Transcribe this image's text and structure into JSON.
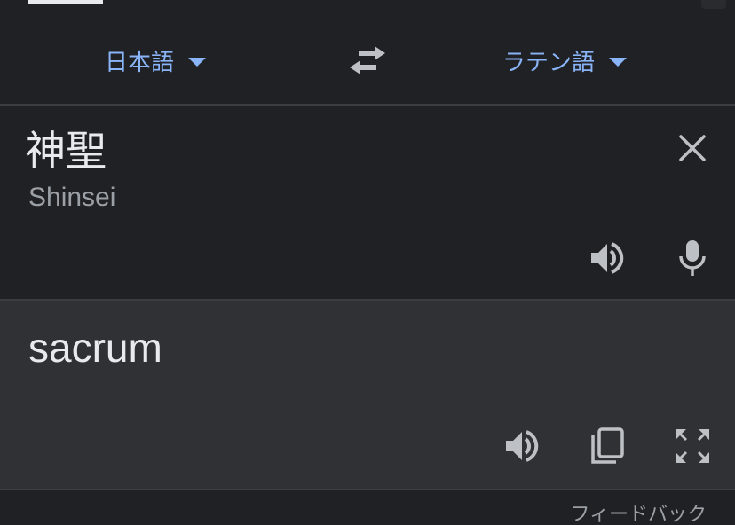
{
  "language_bar": {
    "source_language": "日本語",
    "target_language": "ラテン語",
    "swap_icon": "swap-horiz-icon"
  },
  "input": {
    "text": "神聖",
    "romanization": "Shinsei",
    "icons": [
      "close-icon",
      "volume-icon",
      "microphone-icon"
    ]
  },
  "output": {
    "text": "sacrum",
    "icons": [
      "volume-icon",
      "copy-icon",
      "fullscreen-icon"
    ]
  },
  "footer": {
    "feedback_label": "フィードバック"
  },
  "colors": {
    "background": "#202124",
    "output_background": "#303134",
    "accent": "#8ab4f8",
    "text_primary": "#e8eaed",
    "text_secondary": "#9aa0a6",
    "icon": "#bdc1c6"
  }
}
